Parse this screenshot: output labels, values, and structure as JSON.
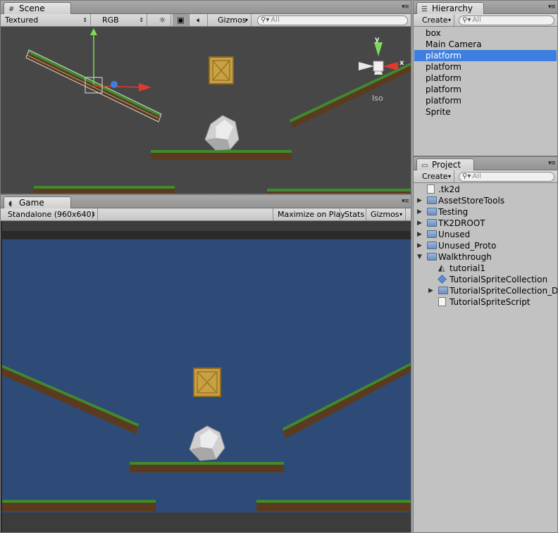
{
  "scene": {
    "tab_label": "Scene",
    "render_mode": "Textured",
    "color_mode": "RGB",
    "gizmos_label": "Gizmos",
    "search_placeholder": "All",
    "axis_x": "x",
    "axis_y": "y",
    "projection_label": "Iso"
  },
  "game": {
    "tab_label": "Game",
    "resolution": "Standalone (960x640)",
    "maximize_label": "Maximize on Play",
    "stats_label": "Stats",
    "gizmos_label": "Gizmos"
  },
  "hierarchy": {
    "tab_label": "Hierarchy",
    "create_label": "Create",
    "search_placeholder": "All",
    "items": [
      {
        "label": "box",
        "selected": false
      },
      {
        "label": "Main Camera",
        "selected": false
      },
      {
        "label": "platform",
        "selected": true
      },
      {
        "label": "platform",
        "selected": false
      },
      {
        "label": "platform",
        "selected": false
      },
      {
        "label": "platform",
        "selected": false
      },
      {
        "label": "platform",
        "selected": false
      },
      {
        "label": "Sprite",
        "selected": false
      }
    ]
  },
  "project": {
    "tab_label": "Project",
    "create_label": "Create",
    "search_placeholder": "All",
    "items": [
      {
        "label": ".tk2d",
        "icon": "file-icon",
        "depth": 0,
        "expanded": null
      },
      {
        "label": "AssetStoreTools",
        "icon": "folder-icon",
        "depth": 0,
        "expanded": false
      },
      {
        "label": "Testing",
        "icon": "folder-icon",
        "depth": 0,
        "expanded": false
      },
      {
        "label": "TK2DROOT",
        "icon": "folder-icon",
        "depth": 0,
        "expanded": false
      },
      {
        "label": "Unused",
        "icon": "folder-icon",
        "depth": 0,
        "expanded": false
      },
      {
        "label": "Unused_Proto",
        "icon": "folder-icon",
        "depth": 0,
        "expanded": false
      },
      {
        "label": "Walkthrough",
        "icon": "folder-icon",
        "depth": 0,
        "expanded": true
      },
      {
        "label": "tutorial1",
        "icon": "unity-scene-icon",
        "depth": 1,
        "expanded": null
      },
      {
        "label": "TutorialSpriteCollection",
        "icon": "prefab-icon",
        "depth": 1,
        "expanded": null
      },
      {
        "label": "TutorialSpriteCollection_Da",
        "icon": "folder-icon",
        "depth": 1,
        "expanded": false
      },
      {
        "label": "TutorialSpriteScript",
        "icon": "script-icon",
        "depth": 1,
        "expanded": null
      }
    ]
  },
  "colors": {
    "scene_bg": "#474747",
    "game_bg": "#2e4b78",
    "selection": "#3d7fe0",
    "grass": "#3f8a2e",
    "dirt": "#5a3b1f",
    "crate": "#c9a042"
  }
}
